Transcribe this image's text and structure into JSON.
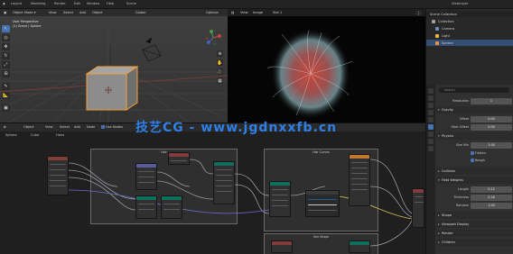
{
  "topbar": {
    "menus": [
      "Layout",
      "Modeling",
      "Render",
      "Edit",
      "Window",
      "Help"
    ],
    "scene_label": "Scene",
    "viewlayer_label": "ViewLayer"
  },
  "viewport3d": {
    "view_label": "User Perspective",
    "collection_label": "(1) Scene | Sphere",
    "shading_label": "Global",
    "options_label": "Options"
  },
  "render": {
    "view_label": "View",
    "image_label": "Image",
    "slot_label": "Slot 1"
  },
  "outliner": {
    "title": "Scene Collection",
    "items": [
      {
        "name": "Collection",
        "color": "#a0a0a0"
      },
      {
        "name": "Camera",
        "color": "#6a8dc0"
      },
      {
        "name": "Light",
        "color": "#e8b84a"
      },
      {
        "name": "Sphere",
        "color": "#e89050"
      }
    ]
  },
  "properties": {
    "search_placeholder": "Search",
    "rows": [
      {
        "label": "Resolution",
        "value": "1"
      },
      {
        "label": "Offset",
        "value": "0.00"
      },
      {
        "label": "Start Offset",
        "value": "0.00"
      },
      {
        "label": "Size Min",
        "value": "1.00"
      }
    ],
    "sections": [
      "Gravity",
      "Physics",
      "Collision",
      "Field Weights",
      "Shape",
      "Viewport Display"
    ],
    "checks": [
      {
        "label": "Flatten",
        "on": true
      },
      {
        "label": "Rough",
        "on": true
      }
    ],
    "extra_rows": [
      {
        "label": "Length",
        "value": "0.12"
      },
      {
        "label": "Thickness",
        "value": "0.18"
      },
      {
        "label": "Random",
        "value": "1.00"
      }
    ]
  },
  "node_editor": {
    "header_items": [
      "Object",
      "View",
      "Select",
      "Add",
      "Node",
      "Use Nodes"
    ],
    "breadcrumb": [
      "Sphere",
      "Cube",
      "Hairs"
    ],
    "frames": [
      "Hair",
      "Hair Curves",
      "Hair Shape"
    ]
  },
  "watermark": "技艺CG - www.jgdnxxfb.cn",
  "colors": {
    "selection_orange": "#f5a033",
    "node_geometry": "#0f6e5c",
    "node_input": "#833c3c",
    "node_vector": "#5a5aa0",
    "node_output": "#5d3a6b",
    "wire": "#9a9aa5"
  }
}
